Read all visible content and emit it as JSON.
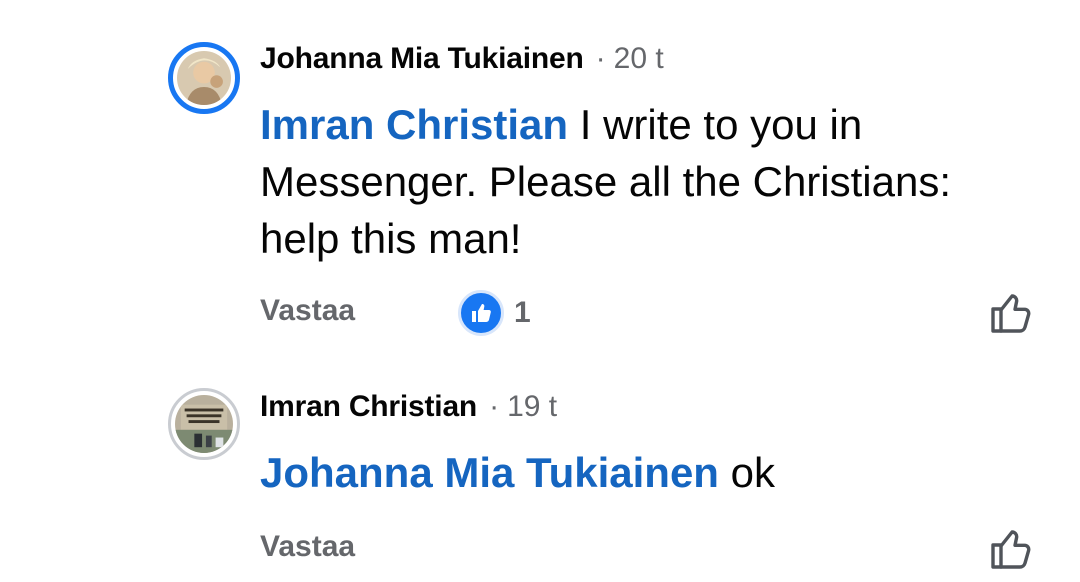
{
  "comments": [
    {
      "author": "Johanna Mia Tukiainen",
      "separator": "·",
      "time": "20 t",
      "mention": "Imran Christian",
      "text": " I write to you in Messenger. Please all the Christians: help this man!",
      "reply_label": "Vastaa",
      "reaction_count": "1",
      "avatar_icon": "profile-photo-icon",
      "like_icon": "thumbs-up-outline-icon"
    },
    {
      "author": "Imran Christian",
      "separator": "·",
      "time": "19 t",
      "mention": "Johanna Mia Tukiainen",
      "text": " ok",
      "reply_label": "Vastaa",
      "avatar_icon": "profile-photo-icon",
      "like_icon": "thumbs-up-outline-icon"
    }
  ],
  "colors": {
    "accent": "#1877f2",
    "mention": "#1565c0",
    "secondary_text": "#65676b"
  }
}
